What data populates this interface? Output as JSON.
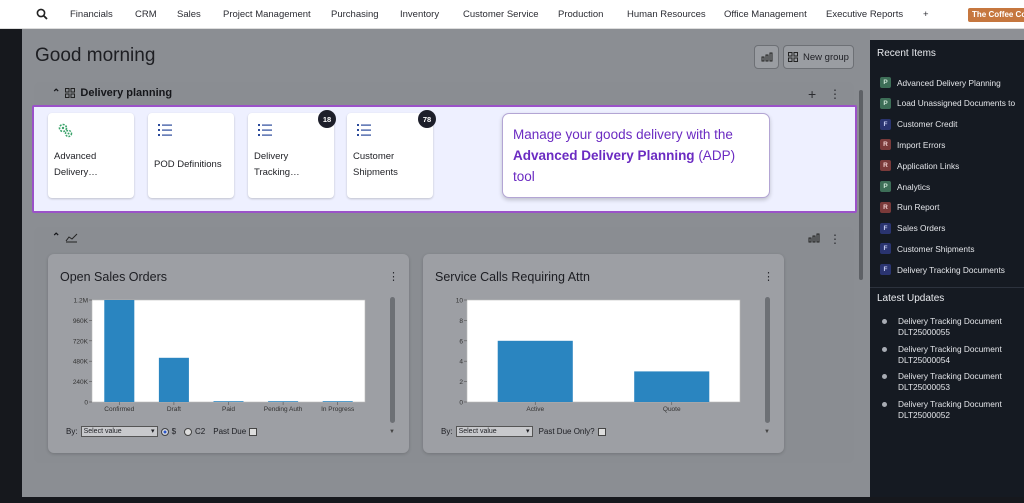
{
  "topnav": {
    "items": [
      "Financials",
      "CRM",
      "Sales",
      "Project Management",
      "Purchasing",
      "Inventory",
      "Customer Service",
      "Production",
      "Human Resources",
      "Office Management",
      "Executive Reports",
      "+"
    ],
    "company": "The Coffee Co"
  },
  "header": {
    "greeting": "Good morning",
    "new_group_label": "New group"
  },
  "delivery_panel": {
    "title": "Delivery planning",
    "add_label": "+",
    "more_label": "⋮",
    "tiles": [
      {
        "label": "Advanced Delivery…",
        "icon": "gears-icon",
        "badge": ""
      },
      {
        "label": "POD Definitions",
        "icon": "list-icon",
        "badge": ""
      },
      {
        "label": "Delivery Tracking…",
        "icon": "list-icon",
        "badge": "18"
      },
      {
        "label": "Customer Shipments",
        "icon": "list-icon",
        "badge": "78"
      }
    ],
    "callout": {
      "prefix": "Manage your goods delivery with the ",
      "bold": "Advanced Delivery Planning",
      "suffix": " (ADP) tool"
    }
  },
  "charts_panel": {
    "more_label": "⋮",
    "cards": [
      {
        "title": "Open Sales Orders",
        "filter": {
          "by_label": "By:",
          "select_value": "Select value",
          "radio_dollar": "$",
          "radio_c2": "C2",
          "checkbox_label": "Past Due"
        }
      },
      {
        "title": "Service Calls Requiring Attn",
        "filter": {
          "by_label": "By:",
          "select_value": "Select value",
          "checkbox_label": "Past Due Only?"
        }
      }
    ]
  },
  "chart_data": [
    {
      "type": "bar",
      "title": "Open Sales Orders",
      "categories": [
        "Confirmed",
        "Draft",
        "Paid",
        "Pending Auth",
        "In Progress"
      ],
      "values": [
        1240000,
        520000,
        8000,
        3000,
        3000
      ],
      "ylim": [
        0,
        1200000
      ],
      "yticks": [
        "0",
        "240K",
        "480K",
        "720K",
        "960K",
        "1.2M"
      ],
      "xlabel": "",
      "ylabel": "",
      "color": "#2a85c0"
    },
    {
      "type": "bar",
      "title": "Service Calls Requiring Attn",
      "categories": [
        "Active",
        "Quote"
      ],
      "values": [
        6,
        3
      ],
      "ylim": [
        0,
        10
      ],
      "yticks": [
        "0",
        "2",
        "4",
        "6",
        "8",
        "10"
      ],
      "xlabel": "",
      "ylabel": "",
      "color": "#2a85c0"
    }
  ],
  "sidebar": {
    "recent_title": "Recent Items",
    "recent_items": [
      {
        "tag": "P",
        "label": "Advanced Delivery Planning"
      },
      {
        "tag": "P",
        "label": "Load Unassigned Documents to"
      },
      {
        "tag": "F",
        "label": "Customer Credit"
      },
      {
        "tag": "R",
        "label": "Import Errors"
      },
      {
        "tag": "R",
        "label": "Application Links"
      },
      {
        "tag": "P",
        "label": "Analytics"
      },
      {
        "tag": "R",
        "label": "Run Report"
      },
      {
        "tag": "F",
        "label": "Sales Orders"
      },
      {
        "tag": "F",
        "label": "Customer Shipments"
      },
      {
        "tag": "F",
        "label": "Delivery Tracking Documents"
      }
    ],
    "updates_title": "Latest Updates",
    "updates": [
      {
        "line1": "Delivery Tracking Document",
        "line2": "DLT25000055"
      },
      {
        "line1": "Delivery Tracking Document",
        "line2": "DLT25000054"
      },
      {
        "line1": "Delivery Tracking Document",
        "line2": "DLT25000053"
      },
      {
        "line1": "Delivery Tracking Document",
        "line2": "DLT25000052"
      }
    ]
  }
}
